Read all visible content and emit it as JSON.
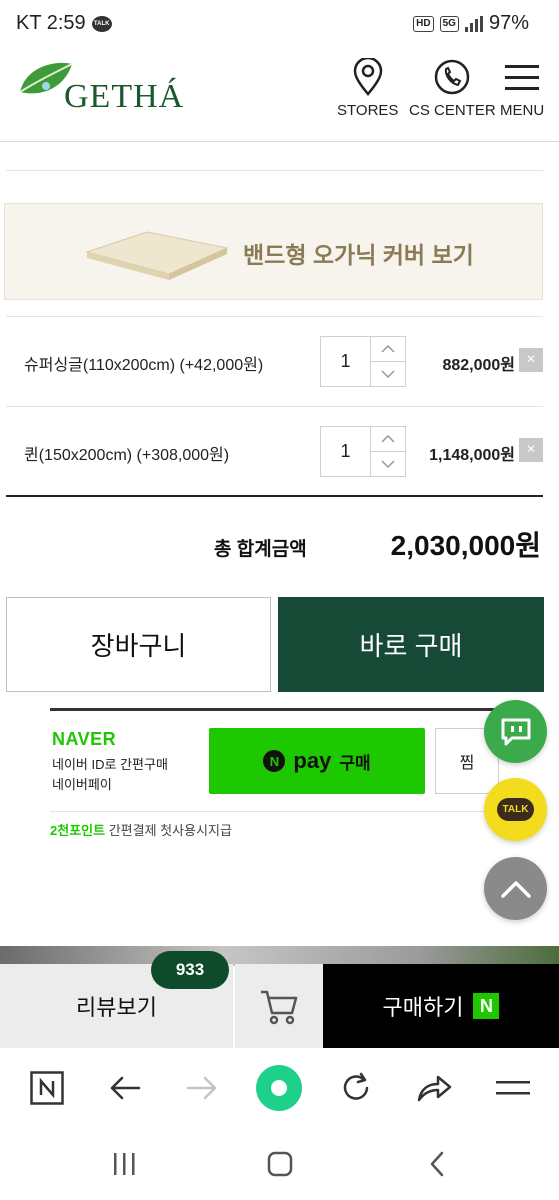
{
  "status_bar": {
    "carrier_time": "KT 2:59",
    "talk_badge": "TALK",
    "hd_badge": "HD",
    "net_badge": "5G",
    "battery": "97%"
  },
  "header": {
    "logo_text": "GETHÁ",
    "nav": [
      {
        "label": "STORES",
        "icon": "location-pin-icon"
      },
      {
        "label": "CS CENTER",
        "icon": "phone-icon"
      },
      {
        "label": "MENU",
        "icon": "hamburger-menu-icon"
      }
    ]
  },
  "banner": {
    "text": "밴드형 오가닉 커버 보기"
  },
  "options": [
    {
      "name": "슈퍼싱글(110x200cm) (+42,000원)",
      "quantity": "1",
      "price": "882,000원"
    },
    {
      "name": "퀸(150x200cm) (+308,000원)",
      "quantity": "1",
      "price": "1,148,000원"
    }
  ],
  "total": {
    "label": "총 합계금액",
    "value": "2,030,000원"
  },
  "buttons": {
    "cart": "장바구니",
    "buy_now": "바로 구매"
  },
  "naver_pay": {
    "brand": "NAVER",
    "sub_line1": "네이버 ID로 간편구매",
    "sub_line2": "네이버페이",
    "pay_n": "N",
    "pay_word": "pay",
    "pay_buy": "구매",
    "wish": "찜",
    "promo_highlight": "2천포인트",
    "promo_rest": " 간편결제 첫사용시지급"
  },
  "floating": {
    "talk_label": "TALK"
  },
  "action_bar": {
    "review": "리뷰보기",
    "review_count": "933",
    "buy": "구매하기",
    "buy_badge": "N"
  },
  "browser_bar": {
    "home_badge": "N"
  },
  "colors": {
    "brand_green_dark": "#174a36",
    "naver_green": "#1ec800",
    "review_badge": "#0e4b2b"
  }
}
